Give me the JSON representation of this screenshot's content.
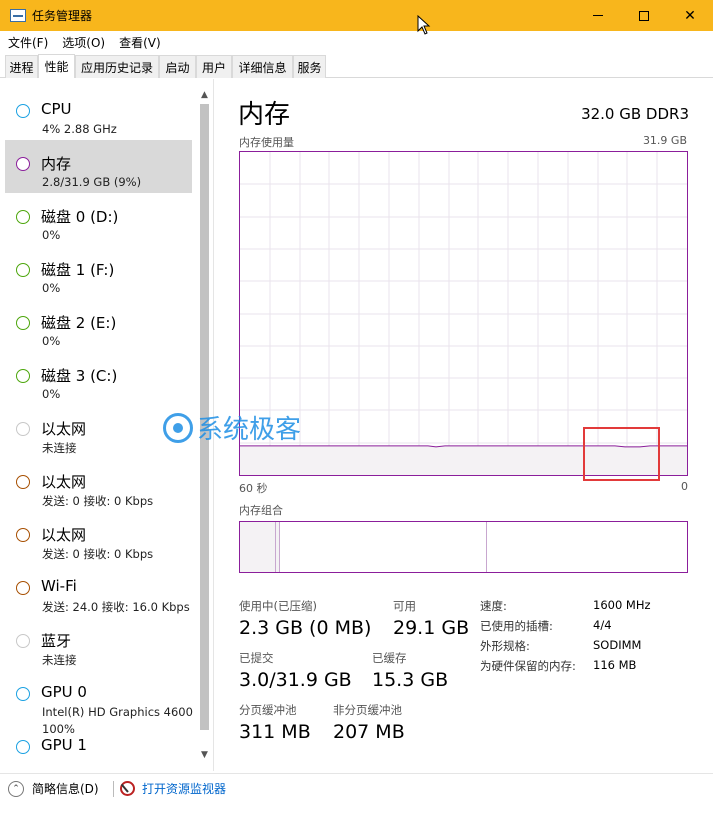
{
  "window": {
    "title": "任务管理器",
    "controls": [
      "minimize",
      "maximize",
      "close"
    ]
  },
  "menu": [
    {
      "label": "文件(F)"
    },
    {
      "label": "选项(O)"
    },
    {
      "label": "查看(V)"
    }
  ],
  "tabs": [
    {
      "label": "进程",
      "active": false
    },
    {
      "label": "性能",
      "active": true
    },
    {
      "label": "应用历史记录",
      "active": false
    },
    {
      "label": "启动",
      "active": false
    },
    {
      "label": "用户",
      "active": false
    },
    {
      "label": "详细信息",
      "active": false
    },
    {
      "label": "服务",
      "active": false
    }
  ],
  "sidebar": {
    "items": [
      {
        "title": "CPU",
        "sub": "4% 2.88 GHz",
        "color": "#1ba1e2",
        "active": false
      },
      {
        "title": "内存",
        "sub": "2.8/31.9 GB (9%)",
        "color": "#8b1e9b",
        "active": true
      },
      {
        "title": "磁盘 0 (D:)",
        "sub": "0%",
        "color": "#4da60c",
        "active": false
      },
      {
        "title": "磁盘 1 (F:)",
        "sub": "0%",
        "color": "#4da60c",
        "active": false
      },
      {
        "title": "磁盘 2 (E:)",
        "sub": "0%",
        "color": "#4da60c",
        "active": false
      },
      {
        "title": "磁盘 3 (C:)",
        "sub": "0%",
        "color": "#4da60c",
        "active": false
      },
      {
        "title": "以太网",
        "sub": "未连接",
        "color": "#c8c8c8",
        "active": false
      },
      {
        "title": "以太网",
        "sub": "发送: 0 接收: 0 Kbps",
        "color": "#a74f01",
        "active": false
      },
      {
        "title": "以太网",
        "sub": "发送: 0 接收: 0 Kbps",
        "color": "#a74f01",
        "active": false
      },
      {
        "title": "Wi-Fi",
        "sub": "发送: 24.0 接收: 16.0 Kbps",
        "color": "#a74f01",
        "active": false
      },
      {
        "title": "蓝牙",
        "sub": "未连接",
        "color": "#c8c8c8",
        "active": false
      },
      {
        "title": "GPU 0",
        "sub": "Intel(R) HD Graphics 4600",
        "sub2": "100%",
        "color": "#1ba1e2",
        "active": false
      },
      {
        "title": "GPU 1",
        "sub": "",
        "color": "#1ba1e2",
        "active": false
      }
    ]
  },
  "main": {
    "title": "内存",
    "spec": "32.0 GB DDR3",
    "usage_graph": {
      "label": "内存使用量",
      "max_label": "31.9 GB",
      "time_left": "60 秒",
      "time_right": "0",
      "line_color": "#8b1e9b",
      "fill_color": "#f4f2f4",
      "usage_fraction": 0.09
    },
    "composition_label": "内存组合",
    "stats": {
      "in_use_label": "使用中(已压缩)",
      "in_use_value": "2.3 GB (0 MB)",
      "available_label": "可用",
      "available_value": "29.1 GB",
      "committed_label": "已提交",
      "committed_value": "3.0/31.9 GB",
      "cached_label": "已缓存",
      "cached_value": "15.3 GB",
      "paged_label": "分页缓冲池",
      "paged_value": "311 MB",
      "nonpaged_label": "非分页缓冲池",
      "nonpaged_value": "207 MB"
    },
    "details": [
      {
        "key": "速度:",
        "value": "1600 MHz"
      },
      {
        "key": "已使用的插槽:",
        "value": "4/4"
      },
      {
        "key": "外形规格:",
        "value": "SODIMM"
      },
      {
        "key": "为硬件保留的内存:",
        "value": "116 MB"
      }
    ]
  },
  "watermark": "系统极客",
  "footer": {
    "fewer_details": "简略信息(D)",
    "open_monitor": "打开资源监视器"
  }
}
